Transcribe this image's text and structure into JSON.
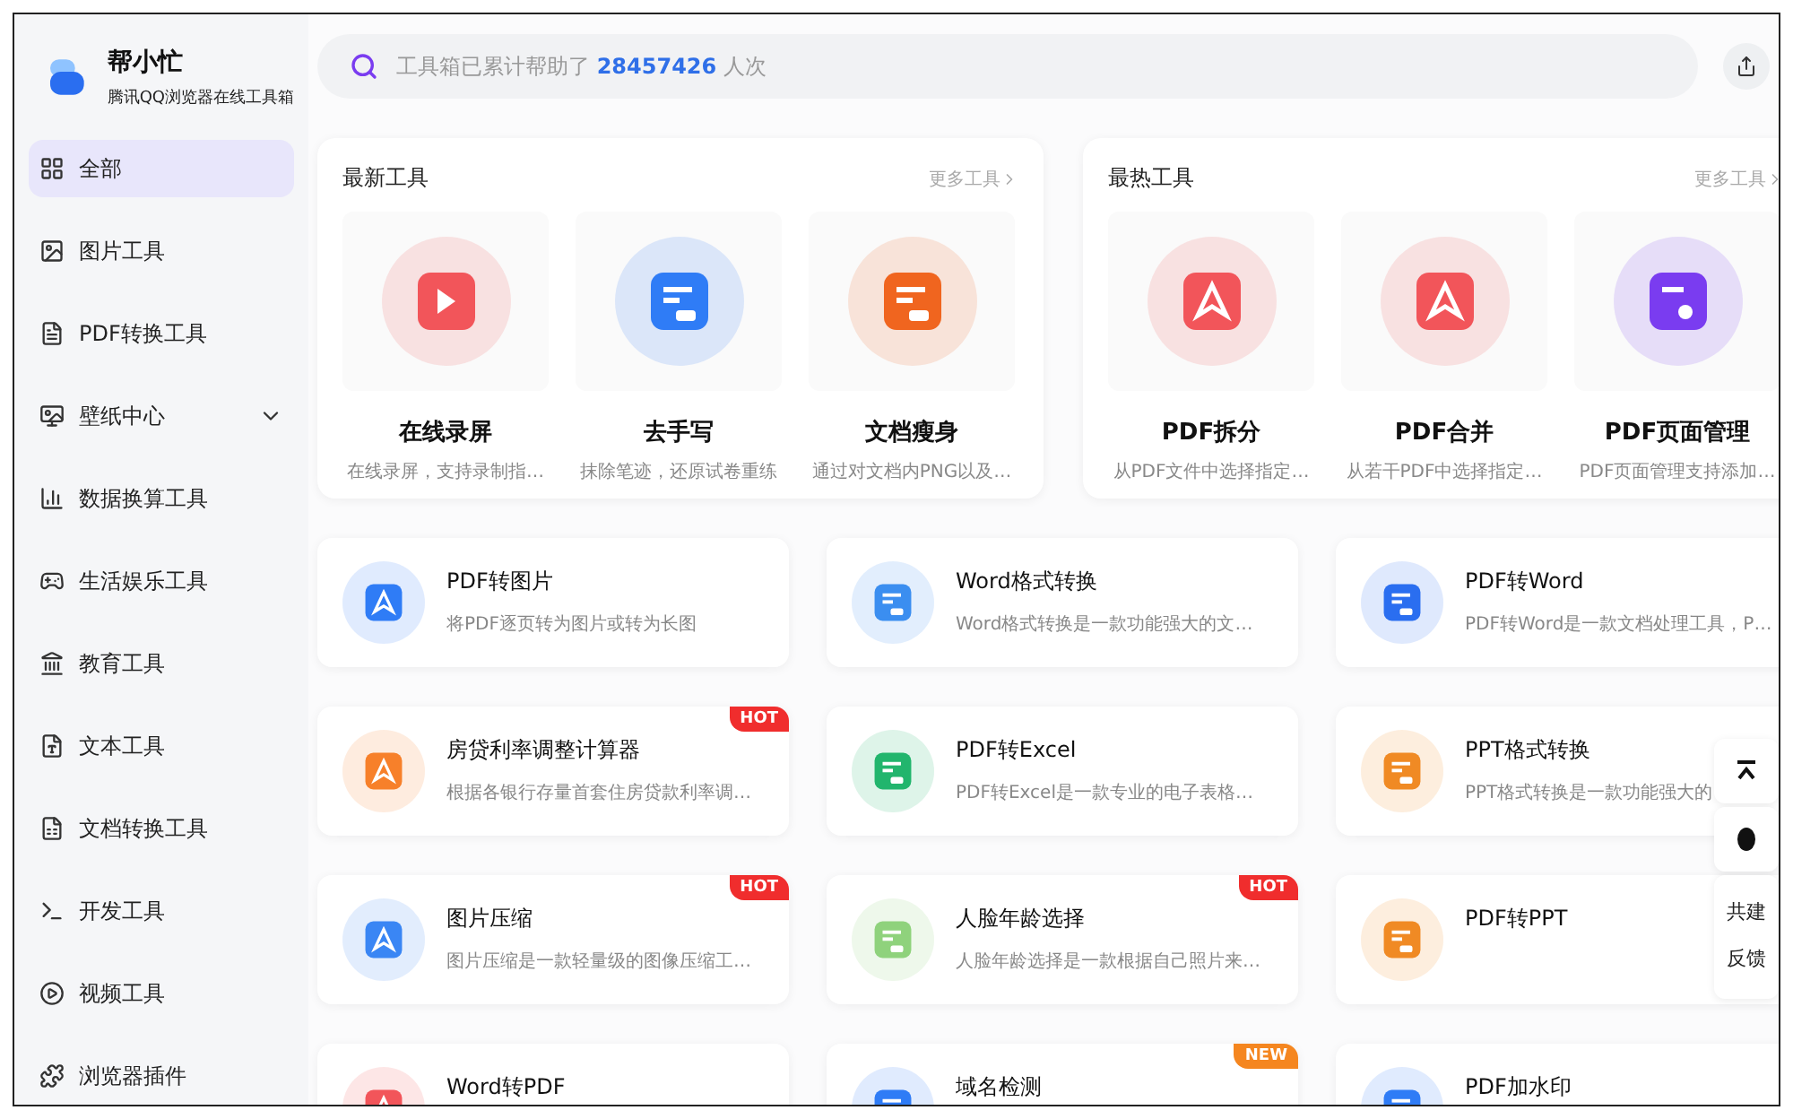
{
  "brand": {
    "title": "帮小忙",
    "subtitle": "腾讯QQ浏览器在线工具箱"
  },
  "sidebar": {
    "items": [
      {
        "label": "全部",
        "selected": true,
        "kind": "link"
      },
      {
        "label": "图片工具",
        "selected": false,
        "kind": "link"
      },
      {
        "label": "PDF转换工具",
        "selected": false,
        "kind": "link"
      },
      {
        "label": "壁纸中心",
        "selected": false,
        "kind": "group",
        "expanded": false
      },
      {
        "label": "数据换算工具",
        "selected": false,
        "kind": "link"
      },
      {
        "label": "生活娱乐工具",
        "selected": false,
        "kind": "link"
      },
      {
        "label": "教育工具",
        "selected": false,
        "kind": "link"
      },
      {
        "label": "文本工具",
        "selected": false,
        "kind": "link"
      },
      {
        "label": "文档转换工具",
        "selected": false,
        "kind": "link"
      },
      {
        "label": "开发工具",
        "selected": false,
        "kind": "link"
      },
      {
        "label": "视频工具",
        "selected": false,
        "kind": "link"
      },
      {
        "label": "浏览器插件",
        "selected": false,
        "kind": "link"
      }
    ]
  },
  "search": {
    "prefix": "工具箱已累计帮助了",
    "count": "28457426",
    "suffix": "人次"
  },
  "panels": [
    {
      "title": "最新工具",
      "more": "更多工具",
      "tools": [
        {
          "name": "在线录屏",
          "desc": "在线录屏，支持录制指…",
          "color": "#f2555a"
        },
        {
          "name": "去手写",
          "desc": "抹除笔迹，还原试卷重练",
          "color": "#2f7cf6"
        },
        {
          "name": "文档瘦身",
          "desc": "通过对文档内PNG以及…",
          "color": "#f0651f"
        }
      ]
    },
    {
      "title": "最热工具",
      "more": "更多工具",
      "tools": [
        {
          "name": "PDF拆分",
          "desc": "从PDF文件中选择指定…",
          "color": "#f2555a"
        },
        {
          "name": "PDF合并",
          "desc": "从若干PDF中选择指定…",
          "color": "#f2555a"
        },
        {
          "name": "PDF页面管理",
          "desc": "PDF页面管理支持添加…",
          "color": "#7a3cf0"
        }
      ]
    }
  ],
  "cards": [
    {
      "name": "PDF转图片",
      "desc": "将PDF逐页转为图片或转为长图",
      "color": "#2f7cf6"
    },
    {
      "name": "Word格式转换",
      "desc": "Word格式转换是一款功能强大的文…",
      "color": "#3b8ef0"
    },
    {
      "name": "PDF转Word",
      "desc": "PDF转Word是一款文档处理工具，P…",
      "color": "#2a6ef0"
    },
    {
      "name": "房贷利率调整计算器",
      "desc": "根据各银行存量首套住房贷款利率调…",
      "color": "#f7802a",
      "badge": {
        "text": "HOT",
        "kind": "hot"
      }
    },
    {
      "name": "PDF转Excel",
      "desc": "PDF转Excel是一款专业的电子表格…",
      "color": "#22b56d"
    },
    {
      "name": "PPT格式转换",
      "desc": "PPT格式转换是一款功能强大的",
      "color": "#f08a24"
    },
    {
      "name": "图片压缩",
      "desc": "图片压缩是一款轻量级的图像压缩工…",
      "color": "#3a86f4",
      "badge": {
        "text": "HOT",
        "kind": "hot"
      }
    },
    {
      "name": "人脸年龄选择",
      "desc": "人脸年龄选择是一款根据自己照片来…",
      "color": "#8fd27c",
      "badge": {
        "text": "HOT",
        "kind": "hot"
      }
    },
    {
      "name": "PDF转PPT",
      "color": "#f08a24"
    },
    {
      "name": "Word转PDF",
      "color": "#f2555a"
    },
    {
      "name": "域名检测",
      "color": "#2f7cf6",
      "badge": {
        "text": "NEW",
        "kind": "new"
      }
    },
    {
      "name": "PDF加水印",
      "color": "#2f7cf6"
    }
  ],
  "float_bar": {
    "feedback": "共建反馈"
  }
}
